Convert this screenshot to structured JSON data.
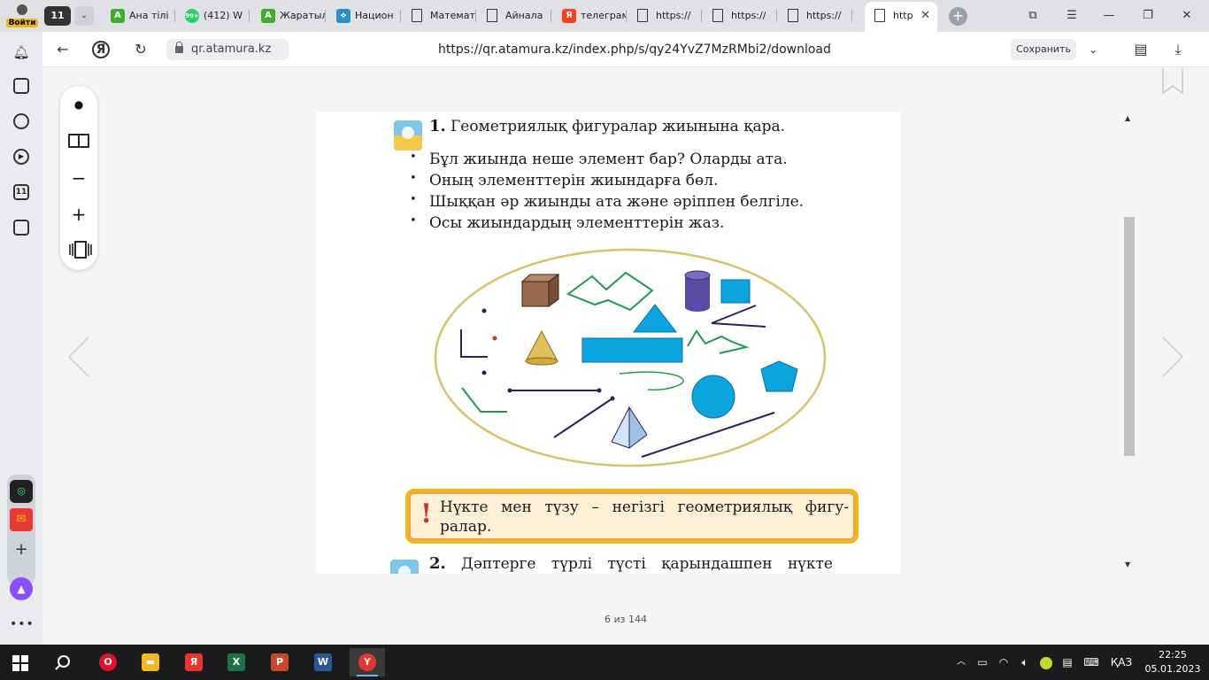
{
  "browser": {
    "user_button_label": "Войти",
    "tab_count": "11",
    "tabs": [
      {
        "title": "Ана тілі",
        "favicon": "A",
        "favicon_color": "#3dae2b"
      },
      {
        "title": "(412) W",
        "favicon": "99+",
        "favicon_color": "#25d366"
      },
      {
        "title": "Жаратылыс",
        "favicon": "A",
        "favicon_color": "#3dae2b"
      },
      {
        "title": "Национ",
        "favicon": "⟡",
        "favicon_color": "#2b8fc7"
      },
      {
        "title": "Математ",
        "favicon": "▯",
        "favicon_color": "#ffffff"
      },
      {
        "title": "Айнала",
        "favicon": "▯",
        "favicon_color": "#ffffff"
      },
      {
        "title": "телеграм",
        "favicon": "Я",
        "favicon_color": "#fc3f1d"
      },
      {
        "title": "https://",
        "favicon": "▯",
        "favicon_color": "#ffffff"
      },
      {
        "title": "https://",
        "favicon": "▯",
        "favicon_color": "#ffffff"
      },
      {
        "title": "https://",
        "favicon": "▯",
        "favicon_color": "#ffffff"
      },
      {
        "title": "http",
        "favicon": "▯",
        "favicon_color": "#ffffff",
        "active": true
      }
    ],
    "domain": "qr.atamura.kz",
    "url": "https://qr.atamura.kz/index.php/s/qy24YvZ7MzRMbi2/download",
    "save_label": "Сохранить"
  },
  "viewer": {
    "page_indicator": "6 из 144",
    "zoom_tools": [
      "dot-icon",
      "two-pages-icon",
      "zoom-out-icon",
      "zoom-in-icon",
      "fit-page-icon"
    ]
  },
  "textbook": {
    "task1": {
      "number": "1.",
      "title": "Геометриялық фигуралар жиынына қара.",
      "bullets": [
        "Бұл жиында неше элемент бар? Оларды ата.",
        "Оның элементтерін жиындарға бөл.",
        "Шыққан әр жиынды ата және әріппен белгіле.",
        "Осы жиындардың элементтерін жаз."
      ]
    },
    "note": {
      "mark": "!",
      "line1": "Нүкте мен түзу – негізгі геометриялық фигу-",
      "line2": "ралар."
    },
    "task2": {
      "number": "2.",
      "text": "Дәптерге түрлі түсті қарындашпен нүкте"
    },
    "figure_colors": {
      "ellipse": "#d9c36a",
      "blue_fill": "#0ba4e0",
      "cube": "#9a6a4e",
      "cylinder": "#5b4aa6",
      "cone": "#e2bf5c",
      "pyramid": "#b9d6ee",
      "green_line": "#1f9a4a",
      "navy_line": "#27235e",
      "red_dot": "#c0392b"
    }
  },
  "taskbar": {
    "apps": [
      {
        "name": "opera",
        "glyph": "O",
        "color": "#e0122a"
      },
      {
        "name": "file-explorer",
        "glyph": "▬",
        "color": "#f3b723"
      },
      {
        "name": "yandex",
        "glyph": "Я",
        "color": "#e5352f"
      },
      {
        "name": "excel",
        "glyph": "X",
        "color": "#1e7244"
      },
      {
        "name": "powerpoint",
        "glyph": "P",
        "color": "#c9472a"
      },
      {
        "name": "word",
        "glyph": "W",
        "color": "#2b5797"
      },
      {
        "name": "yandex-browser",
        "glyph": "Y",
        "color": "#e5352f",
        "active": true
      }
    ],
    "language": "ҚАЗ",
    "time": "22:25",
    "date": "05.01.2023"
  }
}
